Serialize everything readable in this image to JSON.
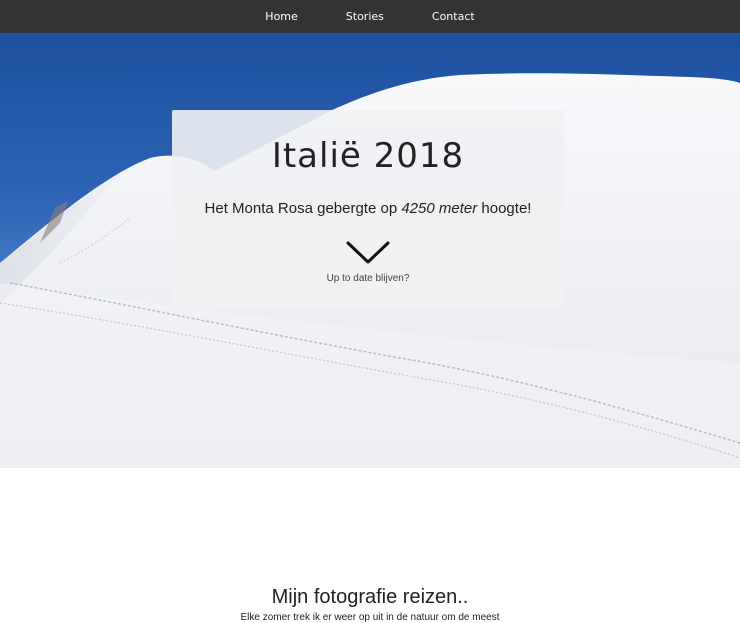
{
  "nav": {
    "items": [
      {
        "label": "Home"
      },
      {
        "label": "Stories"
      },
      {
        "label": "Contact"
      }
    ]
  },
  "hero": {
    "title": "Italië 2018",
    "subtitle_before": "Het Monta Rosa gebergte op ",
    "subtitle_emphasis": "4250 meter",
    "subtitle_after": " hoogte!",
    "cta": "Up to date blijven?",
    "cta_icon": "chevron-down-icon"
  },
  "intro": {
    "title": "Mijn fotografie reizen..",
    "text": "Elke zomer trek ik er weer op uit in de natuur om de meest"
  },
  "colors": {
    "navbar": "#333333",
    "sky": "#2c62b4",
    "snow": "#f2f3f5",
    "card": "#f0f1f3"
  }
}
